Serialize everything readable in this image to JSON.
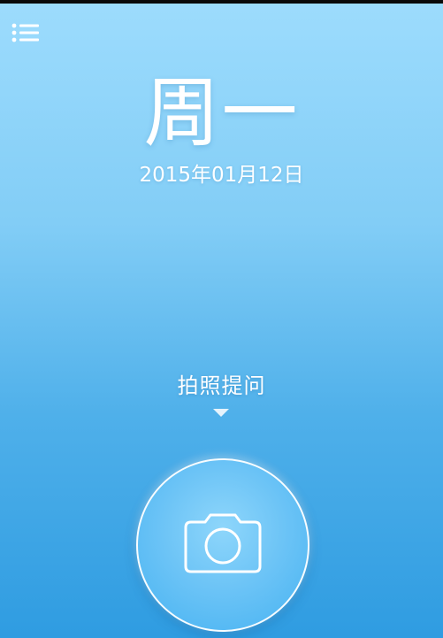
{
  "status_bar": {
    "color": "#0a0a0a"
  },
  "header": {
    "menu_icon": "list-menu-icon"
  },
  "main": {
    "day": "周一",
    "date": "2015年01月12日",
    "photo_label": "拍照提问",
    "arrow_icon": "triangle-down-icon",
    "camera_icon": "camera-icon"
  },
  "colors": {
    "gradient_top": "#9ddcfd",
    "gradient_bottom": "#2f9ce1",
    "button_fill": "#6dc4f6",
    "text": "#ffffff"
  }
}
